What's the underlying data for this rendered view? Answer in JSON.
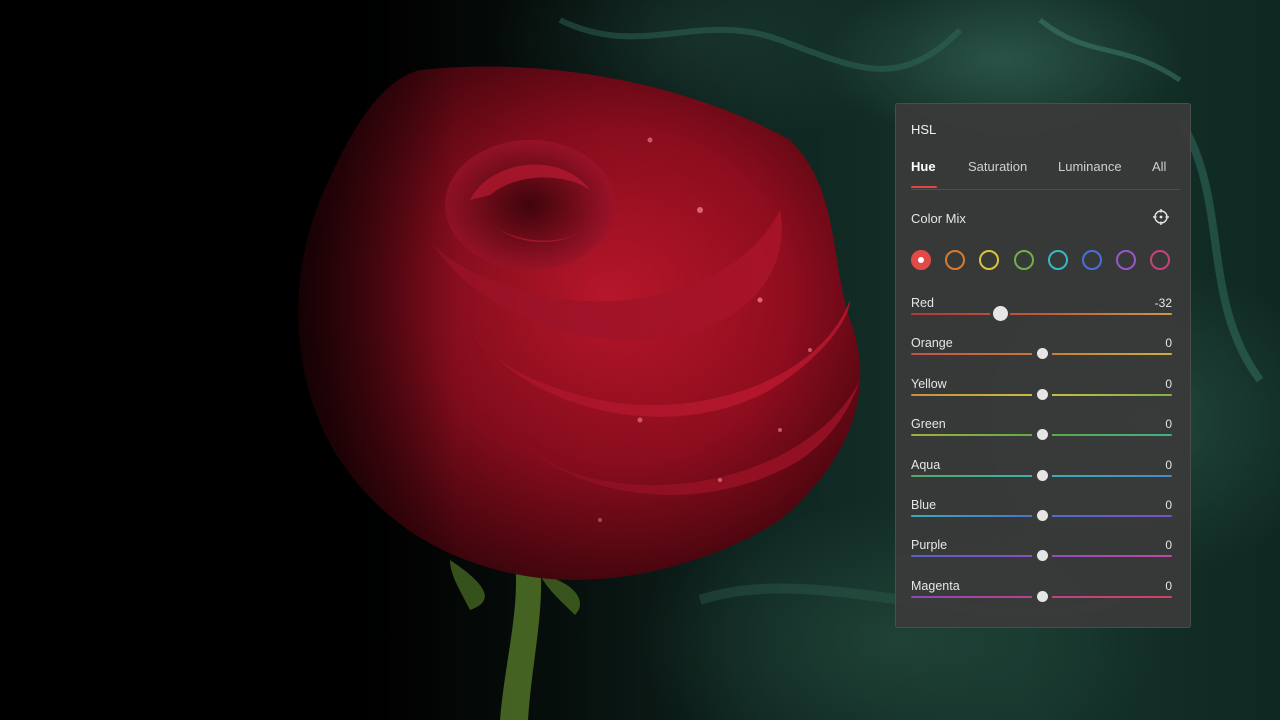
{
  "panel": {
    "title": "HSL",
    "tabs": [
      {
        "label": "Hue",
        "active": true
      },
      {
        "label": "Saturation",
        "active": false
      },
      {
        "label": "Luminance",
        "active": false
      },
      {
        "label": "All",
        "active": false
      }
    ],
    "color_mix_label": "Color Mix",
    "target_icon": "target-adjust-icon",
    "swatches": [
      {
        "name": "red",
        "color": "#e24a4a",
        "selected": true
      },
      {
        "name": "orange",
        "color": "#d97a2e",
        "selected": false
      },
      {
        "name": "yellow",
        "color": "#d8c43a",
        "selected": false
      },
      {
        "name": "green",
        "color": "#6fb04a",
        "selected": false
      },
      {
        "name": "aqua",
        "color": "#36b8c8",
        "selected": false
      },
      {
        "name": "blue",
        "color": "#4a70d8",
        "selected": false
      },
      {
        "name": "purple",
        "color": "#9a55c8",
        "selected": false
      },
      {
        "name": "magenta",
        "color": "#c8407a",
        "selected": false
      }
    ],
    "sliders": [
      {
        "label": "Red",
        "value": "-32",
        "level": -32,
        "track": [
          "#b03a3a",
          "#c05a3a",
          "#c89a4a"
        ]
      },
      {
        "label": "Orange",
        "value": "0",
        "level": 0,
        "track": [
          "#c8504a",
          "#c87a3a",
          "#c8b040"
        ]
      },
      {
        "label": "Yellow",
        "value": "0",
        "level": 0,
        "track": [
          "#c8903a",
          "#c8c040",
          "#80b048"
        ]
      },
      {
        "label": "Green",
        "value": "0",
        "level": 0,
        "track": [
          "#a0b040",
          "#60a848",
          "#40b088"
        ]
      },
      {
        "label": "Aqua",
        "value": "0",
        "level": 0,
        "track": [
          "#58a868",
          "#3ab0b0",
          "#4a88c8"
        ]
      },
      {
        "label": "Blue",
        "value": "0",
        "level": 0,
        "track": [
          "#40a8b8",
          "#4a70c8",
          "#7a50c8"
        ]
      },
      {
        "label": "Purple",
        "value": "0",
        "level": 0,
        "track": [
          "#5a60c8",
          "#8a50c0",
          "#c048a0"
        ]
      },
      {
        "label": "Magenta",
        "value": "0",
        "level": 0,
        "track": [
          "#8a48b8",
          "#c04088",
          "#d04060"
        ]
      }
    ]
  }
}
